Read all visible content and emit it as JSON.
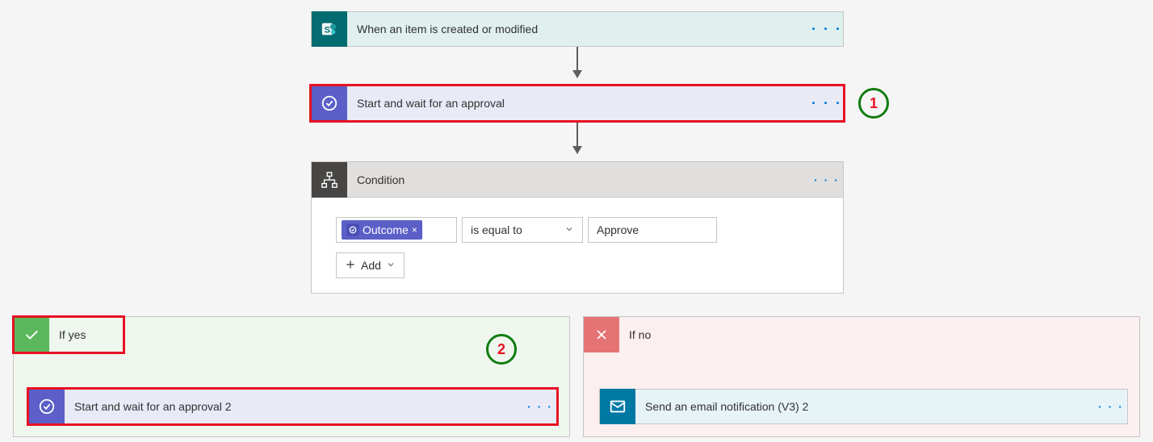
{
  "trigger": {
    "label": "When an item is created or modified",
    "icon": "sharepoint-icon"
  },
  "approval1": {
    "label": "Start and wait for an approval",
    "icon": "approval-icon",
    "annotation": "1"
  },
  "condition": {
    "label": "Condition",
    "token": {
      "label": "Outcome"
    },
    "operator": "is equal to",
    "value": "Approve",
    "add_label": "Add"
  },
  "branches": {
    "yes": {
      "label": "If yes",
      "annotation": "2",
      "action": {
        "label": "Start and wait for an approval 2"
      }
    },
    "no": {
      "label": "If no",
      "action": {
        "label": "Send an email notification (V3) 2"
      }
    }
  },
  "more_dots": "· · ·"
}
